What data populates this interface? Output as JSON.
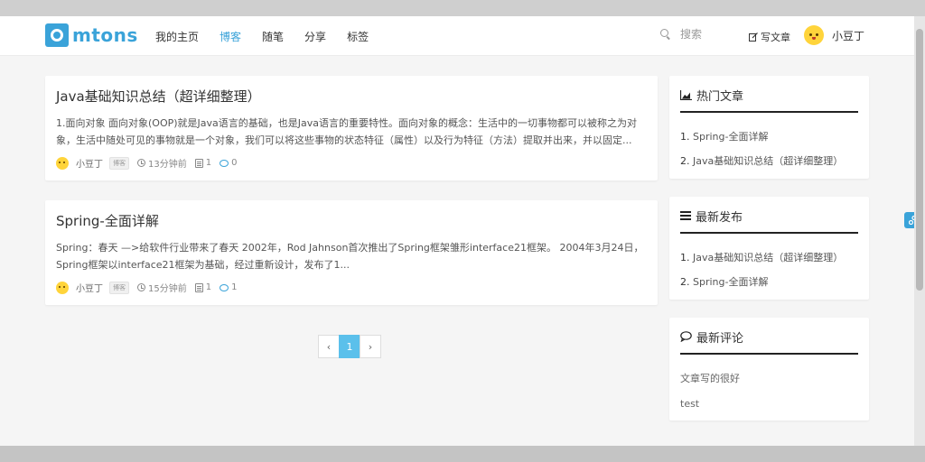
{
  "header": {
    "logo_text": "mtons",
    "nav": [
      {
        "label": "我的主页",
        "active": false
      },
      {
        "label": "博客",
        "active": true
      },
      {
        "label": "随笔",
        "active": false
      },
      {
        "label": "分享",
        "active": false
      },
      {
        "label": "标签",
        "active": false
      }
    ],
    "search_placeholder": "搜索",
    "write_label": "写文章",
    "username": "小豆丁"
  },
  "posts": [
    {
      "title": "Java基础知识总结（超详细整理）",
      "summary": "1.面向对象 面向对象(OOP)就是Java语言的基础，也是Java语言的重要特性。面向对象的概念：生活中的一切事物都可以被称之为对象，生活中随处可见的事物就是一个对象，我们可以将这些事物的状态特征（属性）以及行为特征（方法）提取并出来，并以固定...",
      "author": "小豆丁",
      "tag": "博客",
      "time": "13分钟前",
      "views": "1",
      "comments": "0"
    },
    {
      "title": "Spring-全面详解",
      "summary": "Spring：春天 —>给软件行业带来了春天 2002年，Rod Jahnson首次推出了Spring框架雏形interface21框架。 2004年3月24日，Spring框架以interface21框架为基础，经过重新设计，发布了1...",
      "author": "小豆丁",
      "tag": "博客",
      "time": "15分钟前",
      "views": "1",
      "comments": "1"
    }
  ],
  "pagination": {
    "prev": "‹",
    "current": "1",
    "next": "›"
  },
  "sidebar": {
    "hot": {
      "title": "热门文章",
      "items": [
        {
          "num": "1.",
          "label": "Spring-全面详解"
        },
        {
          "num": "2.",
          "label": "Java基础知识总结（超详细整理）"
        }
      ]
    },
    "latest": {
      "title": "最新发布",
      "items": [
        {
          "num": "1.",
          "label": "Java基础知识总结（超详细整理）"
        },
        {
          "num": "2.",
          "label": "Spring-全面详解"
        }
      ]
    },
    "comments": {
      "title": "最新评论",
      "items": [
        "文章写的很好",
        "test"
      ]
    }
  },
  "colors": {
    "accent": "#3aa3d9",
    "page_active": "#5bc0eb",
    "background": "#f5f5f5"
  },
  "icons": [
    "search-icon",
    "edit-icon",
    "clock-icon",
    "view-icon",
    "comment-icon",
    "chart-icon",
    "list-icon",
    "chat-icon",
    "share-icon"
  ]
}
